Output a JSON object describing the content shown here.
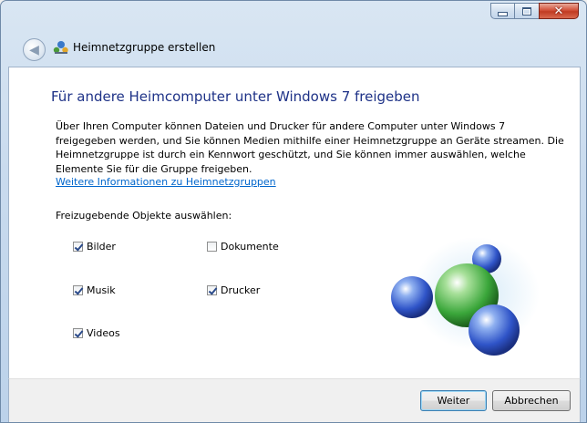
{
  "window": {
    "title": "Heimnetzgruppe erstellen"
  },
  "main": {
    "heading": "Für andere Heimcomputer unter Windows 7 freigeben",
    "description": "Über Ihren Computer können Dateien und Drucker für andere Computer unter Windows 7\nfreigegeben werden, und Sie können Medien mithilfe einer Heimnetzgruppe an Geräte streamen. Die\nHeimnetzgruppe ist durch ein Kennwort geschützt, und Sie können immer auswählen, welche\nElemente Sie für die Gruppe freigeben.",
    "link": "Weitere Informationen zu Heimnetzgruppen",
    "select_label": "Freizugebende Objekte auswählen:",
    "items": [
      {
        "label": "Bilder",
        "checked": true
      },
      {
        "label": "Dokumente",
        "checked": false
      },
      {
        "label": "Musik",
        "checked": true
      },
      {
        "label": "Drucker",
        "checked": true
      },
      {
        "label": "Videos",
        "checked": true
      }
    ]
  },
  "footer": {
    "next_label": "Weiter",
    "cancel_label": "Abbrechen"
  },
  "colors": {
    "heading": "#1e3287",
    "link": "#0066cc",
    "sphere_green": "#3aa63a",
    "sphere_blue": "#2f54c8"
  }
}
